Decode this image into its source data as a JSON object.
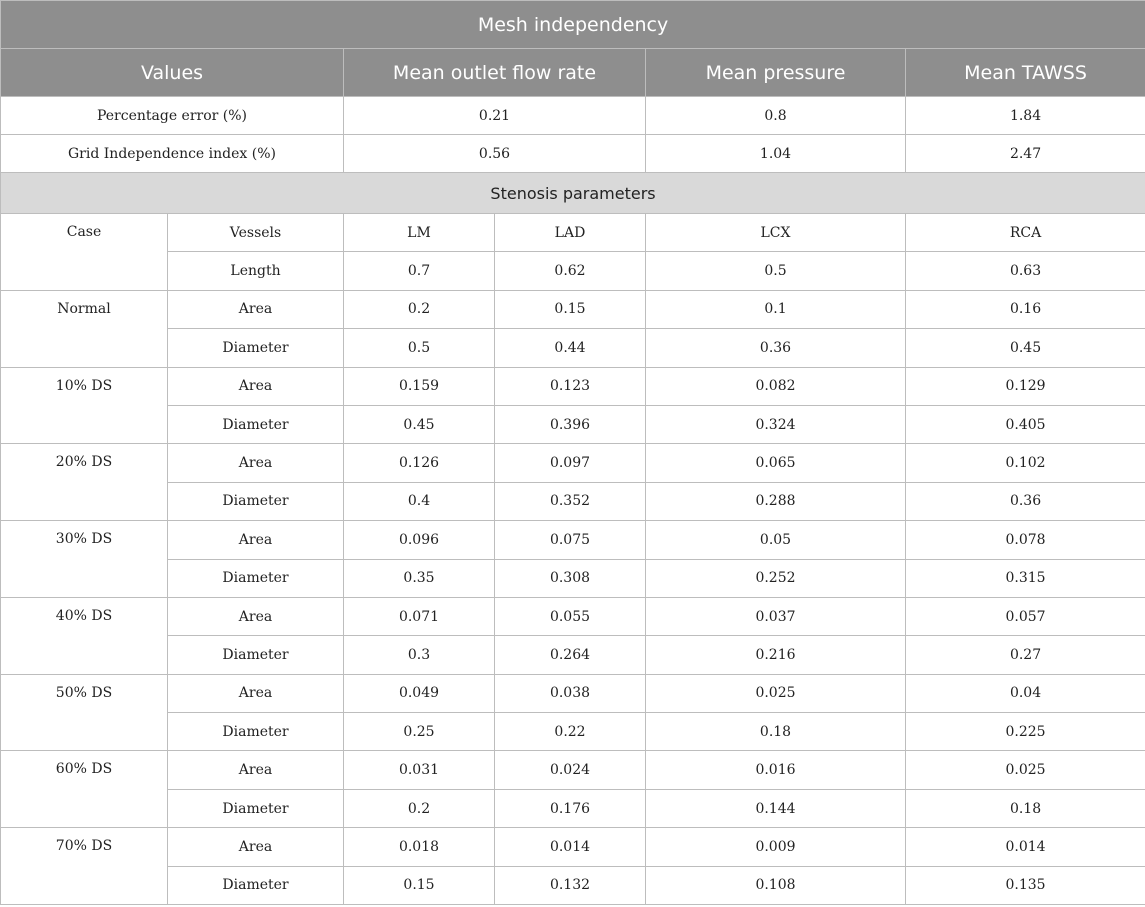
{
  "title": "Mesh independency",
  "mesh": {
    "headers": [
      "Values",
      "Mean outlet flow rate",
      "Mean pressure",
      "Mean TAWSS"
    ],
    "rows": [
      {
        "label": "Percentage error (%)",
        "values": [
          "0.21",
          "0.8",
          "1.84"
        ]
      },
      {
        "label": "Grid Independence index (%)",
        "values": [
          "0.56",
          "1.04",
          "2.47"
        ]
      }
    ]
  },
  "stenosis": {
    "title": "Stenosis parameters",
    "case_header": "Case",
    "vessels_label": "Vessels",
    "vessels": [
      "LM",
      "LAD",
      "LCX",
      "RCA"
    ],
    "length_label": "Length",
    "length_values": [
      "0.7",
      "0.62",
      "0.5",
      "0.63"
    ],
    "area_label": "Area",
    "diameter_label": "Diameter",
    "cases": [
      {
        "name": "Normal",
        "area": [
          "0.2",
          "0.15",
          "0.1",
          "0.16"
        ],
        "diameter": [
          "0.5",
          "0.44",
          "0.36",
          "0.45"
        ]
      },
      {
        "name": "10% DS",
        "area": [
          "0.159",
          "0.123",
          "0.082",
          "0.129"
        ],
        "diameter": [
          "0.45",
          "0.396",
          "0.324",
          "0.405"
        ]
      },
      {
        "name": "20% DS",
        "area": [
          "0.126",
          "0.097",
          "0.065",
          "0.102"
        ],
        "diameter": [
          "0.4",
          "0.352",
          "0.288",
          "0.36"
        ]
      },
      {
        "name": "30% DS",
        "area": [
          "0.096",
          "0.075",
          "0.05",
          "0.078"
        ],
        "diameter": [
          "0.35",
          "0.308",
          "0.252",
          "0.315"
        ]
      },
      {
        "name": "40% DS",
        "area": [
          "0.071",
          "0.055",
          "0.037",
          "0.057"
        ],
        "diameter": [
          "0.3",
          "0.264",
          "0.216",
          "0.27"
        ]
      },
      {
        "name": "50% DS",
        "area": [
          "0.049",
          "0.038",
          "0.025",
          "0.04"
        ],
        "diameter": [
          "0.25",
          "0.22",
          "0.18",
          "0.225"
        ]
      },
      {
        "name": "60% DS",
        "area": [
          "0.031",
          "0.024",
          "0.016",
          "0.025"
        ],
        "diameter": [
          "0.2",
          "0.176",
          "0.144",
          "0.18"
        ]
      },
      {
        "name": "70% DS",
        "area": [
          "0.018",
          "0.014",
          "0.009",
          "0.014"
        ],
        "diameter": [
          "0.15",
          "0.132",
          "0.108",
          "0.135"
        ]
      }
    ]
  }
}
